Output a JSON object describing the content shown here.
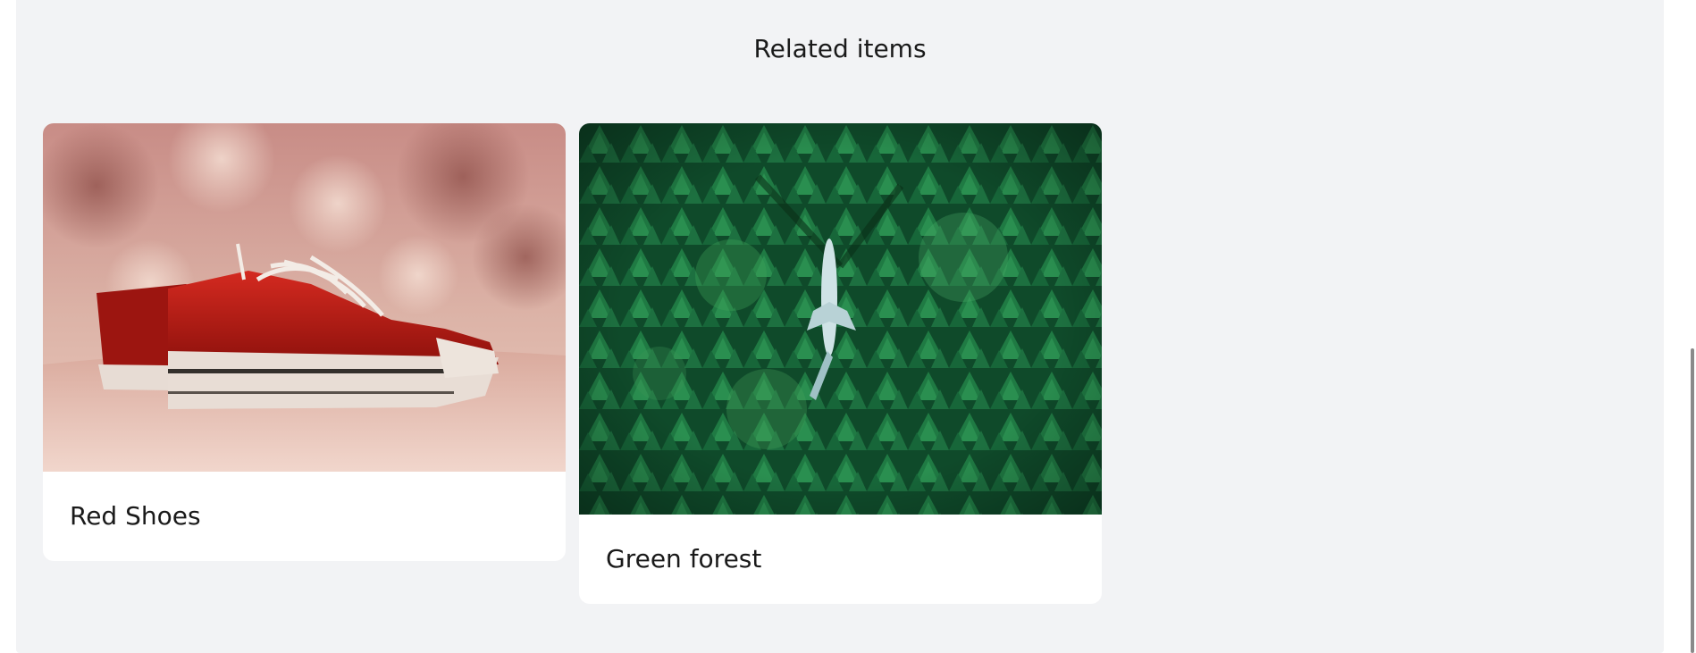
{
  "related": {
    "title": "Related items",
    "items": [
      {
        "label": "Red Shoes",
        "image": "red-sneakers-photo"
      },
      {
        "label": "Green forest",
        "image": "forest-with-airplane-photo"
      }
    ]
  }
}
